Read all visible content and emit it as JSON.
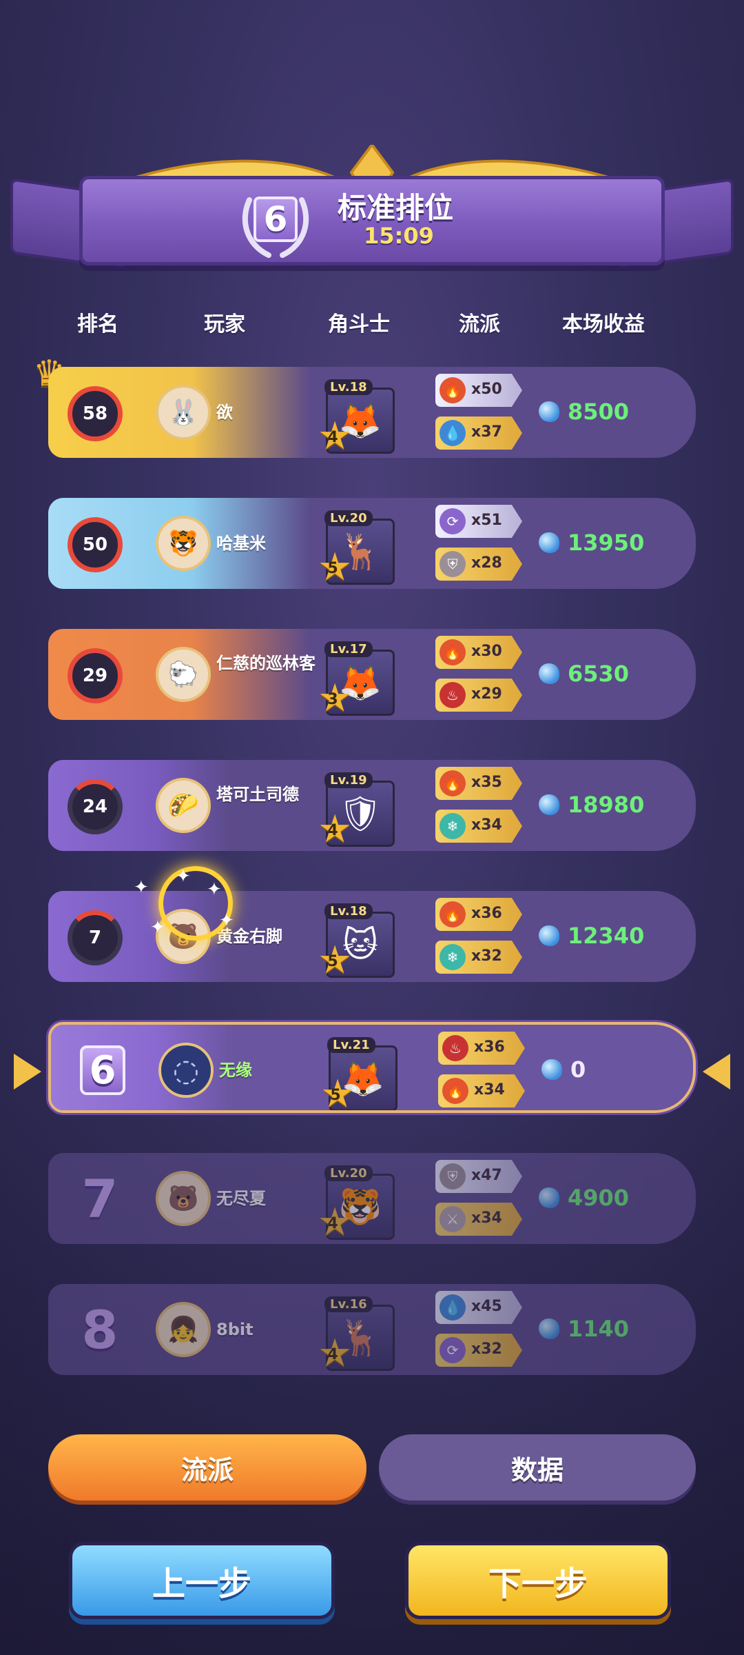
{
  "header": {
    "rank": "6",
    "title": "标准排位",
    "time": "15:09"
  },
  "columns": {
    "rank": "排名",
    "player": "玩家",
    "champion": "角斗士",
    "traits": "流派",
    "earnings": "本场收益"
  },
  "rows": [
    {
      "rank": "58",
      "name": "欲",
      "level": "Lv.18",
      "stars": "4",
      "trait1": "x50",
      "trait1_icon": "fire-icon",
      "trait2": "x37",
      "trait2_icon": "water-icon",
      "earnings": "8500"
    },
    {
      "rank": "50",
      "name": "哈基米",
      "level": "Lv.20",
      "stars": "5",
      "trait1": "x51",
      "trait1_icon": "cycle-icon",
      "trait2": "x28",
      "trait2_icon": "shield-icon",
      "earnings": "13950"
    },
    {
      "rank": "29",
      "name": "仁慈的巡林客",
      "level": "Lv.17",
      "stars": "3",
      "trait1": "x30",
      "trait1_icon": "fire-icon",
      "trait2": "x29",
      "trait2_icon": "flame-icon",
      "earnings": "6530"
    },
    {
      "rank": "24",
      "name": "塔可土司德",
      "level": "Lv.19",
      "stars": "4",
      "trait1": "x35",
      "trait1_icon": "fire-icon",
      "trait2": "x34",
      "trait2_icon": "ice-icon",
      "earnings": "18980"
    },
    {
      "rank": "7",
      "name": "黄金右脚",
      "level": "Lv.18",
      "stars": "5",
      "trait1": "x36",
      "trait1_icon": "fire-icon",
      "trait2": "x32",
      "trait2_icon": "ice-icon",
      "earnings": "12340"
    },
    {
      "rank": "6",
      "name": "无缘",
      "level": "Lv.21",
      "stars": "5",
      "trait1": "x36",
      "trait1_icon": "flame-icon",
      "trait2": "x34",
      "trait2_icon": "fire-icon",
      "earnings": "0"
    },
    {
      "rank": "7",
      "name": "无尽夏",
      "level": "Lv.20",
      "stars": "4",
      "trait1": "x47",
      "trait1_icon": "shield-icon",
      "trait2": "x34",
      "trait2_icon": "sword-icon",
      "earnings": "4900"
    },
    {
      "rank": "8",
      "name": "8bit",
      "level": "Lv.16",
      "stars": "4",
      "trait1": "x45",
      "trait1_icon": "water-icon",
      "trait2": "x32",
      "trait2_icon": "cycle-icon",
      "earnings": "1140"
    }
  ],
  "tabs": {
    "traits": "流派",
    "data": "数据"
  },
  "buttons": {
    "prev": "上一步",
    "next": "下一步"
  },
  "colors": {
    "gold_row": "#f6cf4a",
    "blue_row": "#9fd8f4",
    "orange_row": "#f08a4a",
    "purple_row": "#8a6ad0",
    "earn_green": "#6df07a"
  }
}
